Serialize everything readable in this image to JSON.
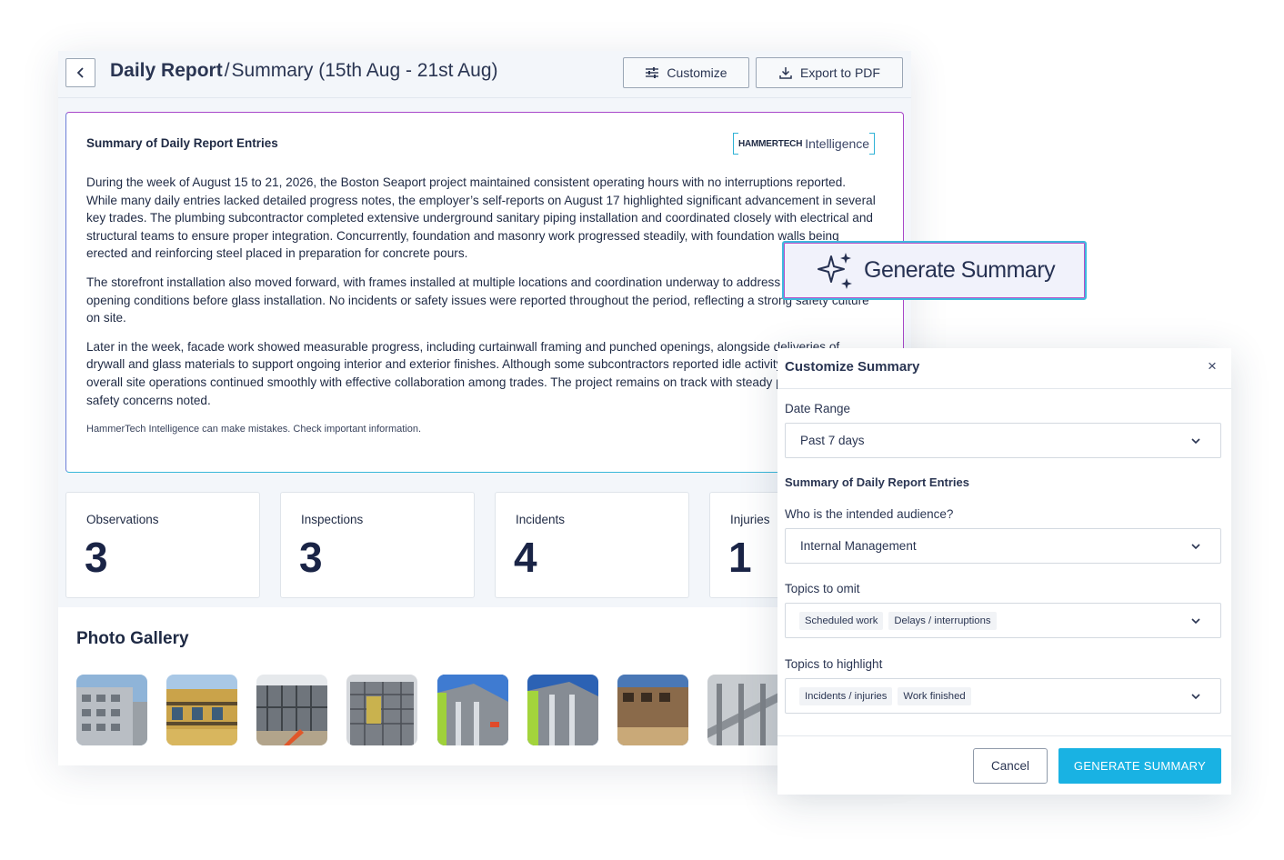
{
  "header": {
    "title_main": "Daily Report",
    "separator": "/",
    "title_sub": "Summary (15th Aug - 21st Aug)",
    "customize_label": "Customize",
    "export_label": "Export to PDF"
  },
  "summary": {
    "title": "Summary of Daily Report Entries",
    "brand_bold": "HAMMERTECH",
    "brand_light": "Intelligence",
    "paragraphs": [
      "During the week of August 15 to 21, 2026, the Boston Seaport project maintained consistent operating hours with no interruptions reported. While many daily entries lacked detailed progress notes, the employer’s self-reports on August 17 highlighted significant advancement in several key trades. The plumbing subcontractor completed extensive underground sanitary piping installation and coordinated closely with electrical and structural teams to ensure proper integration. Concurrently, foundation and masonry work progressed steadily, with foundation walls being erected and reinforcing steel placed in preparation for concrete pours.",
      "The storefront installation also moved forward, with frames installed at multiple locations and coordination underway to address flashing and opening conditions before glass installation. No incidents or safety issues were reported throughout the period, reflecting a strong safety culture on site.",
      "Later in the week, facade work showed measurable progress, including curtainwall framing and punched openings, alongside deliveries of drywall and glass materials to support ongoing interior and exterior finishes. Although some subcontractors reported idle activity on certain days, overall site operations continued smoothly with effective collaboration among trades. The project remains on track with steady progress and no safety concerns noted."
    ],
    "disclaimer": "HammerTech Intelligence can make mistakes. Check important information."
  },
  "stats": [
    {
      "label": "Observations",
      "value": "3"
    },
    {
      "label": "Inspections",
      "value": "3"
    },
    {
      "label": "Incidents",
      "value": "4"
    },
    {
      "label": "Injuries",
      "value": "1"
    }
  ],
  "gallery": {
    "title": "Photo Gallery"
  },
  "generate_badge": {
    "label": "Generate Summary"
  },
  "panel": {
    "title": "Customize Summary",
    "close": "×",
    "date_range_label": "Date Range",
    "date_range_value": "Past 7 days",
    "section_label": "Summary of Daily Report Entries",
    "audience_label": "Who is the intended audience?",
    "audience_value": "Internal Management",
    "omit_label": "Topics to omit",
    "omit_chips": [
      "Scheduled work",
      "Delays / interruptions"
    ],
    "highlight_label": "Topics to highlight",
    "highlight_chips": [
      "Incidents / injuries",
      "Work finished"
    ],
    "cancel_label": "Cancel",
    "generate_label": "GENERATE SUMMARY"
  },
  "colors": {
    "accent_cyan": "#19b2e3",
    "accent_purple": "#a847c9",
    "text_dark": "#1f2a44"
  }
}
